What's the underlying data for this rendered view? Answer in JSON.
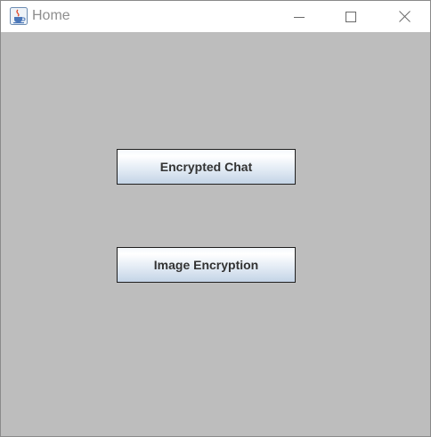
{
  "window": {
    "title": "Home",
    "icon": "java-coffee-icon",
    "controls": {
      "minimize_icon": "minimize-icon",
      "maximize_icon": "maximize-icon",
      "close_icon": "close-icon"
    }
  },
  "main": {
    "buttons": [
      {
        "label": "Encrypted Chat"
      },
      {
        "label": "Image Encryption"
      }
    ]
  },
  "colors": {
    "content_background": "#bdbdbd",
    "button_border": "#1f1f1f",
    "button_text": "#333333",
    "title_text": "#8e8e8e"
  }
}
